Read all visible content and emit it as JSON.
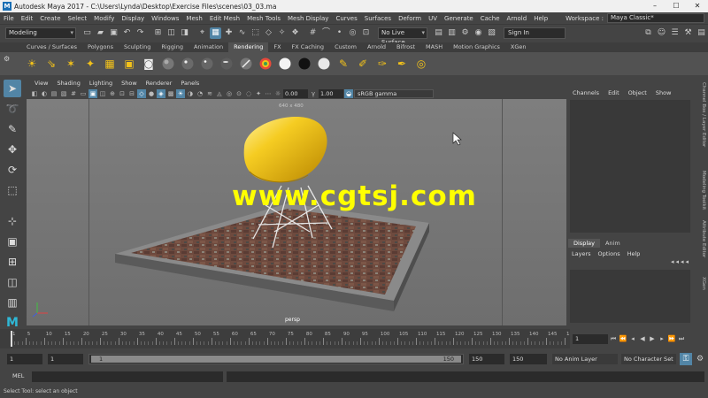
{
  "window": {
    "title": "Autodesk Maya 2017 - C:\\Users\\Lynda\\Desktop\\Exercise Files\\scenes\\03_03.ma",
    "app_icon": "M"
  },
  "menubar": {
    "items": [
      "File",
      "Edit",
      "Create",
      "Select",
      "Modify",
      "Display",
      "Windows",
      "Mesh",
      "Edit Mesh",
      "Mesh Tools",
      "Mesh Display",
      "Curves",
      "Surfaces",
      "Deform",
      "UV",
      "Generate",
      "Cache",
      "Arnold",
      "Help"
    ],
    "workspace_label": "Workspace :",
    "workspace_value": "Maya Classic*"
  },
  "statusline": {
    "menuset": "Modeling",
    "live_surface": "No Live Surface",
    "signin": "Sign In"
  },
  "shelf": {
    "tabs": [
      "Curves / Surfaces",
      "Polygons",
      "Sculpting",
      "Rigging",
      "Animation",
      "Rendering",
      "FX",
      "FX Caching",
      "Custom",
      "Arnold",
      "Bifrost",
      "MASH",
      "Motion Graphics",
      "XGen"
    ],
    "active_tab": "Rendering",
    "icons": [
      "light-sun-icon",
      "light-directional-icon",
      "light-point-icon",
      "light-spot-icon",
      "light-area-icon",
      "light-volume-icon",
      "camera-icon",
      "material-lambert-icon",
      "material-blinn-icon",
      "material-phong-icon",
      "material-anisotropic-icon",
      "material-shading-icon",
      "material-ramp-icon",
      "material-white-icon",
      "material-black-icon",
      "material-gray-icon",
      "render-settings-icon",
      "render-frame-icon",
      "ipr-render-icon",
      "hypershade-icon",
      "render-view-icon"
    ]
  },
  "panel": {
    "menus": [
      "View",
      "Shading",
      "Lighting",
      "Show",
      "Renderer",
      "Panels"
    ],
    "exposure": "0.00",
    "gamma": "1.00",
    "colorspace": "sRGB gamma",
    "resolution": "640 x 480",
    "camera": "persp"
  },
  "watermark": "www.cgtsj.com",
  "channelbox": {
    "menus": [
      "Channels",
      "Edit",
      "Object",
      "Show"
    ]
  },
  "layereditor": {
    "tabs": [
      "Display",
      "Anim"
    ],
    "active_tab": "Display",
    "menus": [
      "Layers",
      "Options",
      "Help"
    ]
  },
  "sidetabs": [
    "Channel Box / Layer Editor",
    "Modeling Toolkit",
    "Attribute Editor",
    "XGen"
  ],
  "timeslider": {
    "ticks": [
      "1",
      "5",
      "10",
      "15",
      "20",
      "25",
      "30",
      "35",
      "40",
      "45",
      "50",
      "55",
      "60",
      "65",
      "70",
      "75",
      "80",
      "85",
      "90",
      "95",
      "100",
      "105",
      "110",
      "115",
      "120",
      "125",
      "130",
      "135",
      "140",
      "145",
      "150"
    ],
    "current_frame": "1"
  },
  "range": {
    "start": "1",
    "playback_start": "1",
    "slider_start": "1",
    "slider_end": "150",
    "playback_end": "150",
    "end": "150",
    "anim_layer": "No Anim Layer",
    "character_set": "No Character Set"
  },
  "command": {
    "label": "MEL"
  },
  "help": "Select Tool: select an object",
  "colors": {
    "accent": "#5285a6",
    "chair": "#f3c21a",
    "watermark": "#ffff00"
  }
}
